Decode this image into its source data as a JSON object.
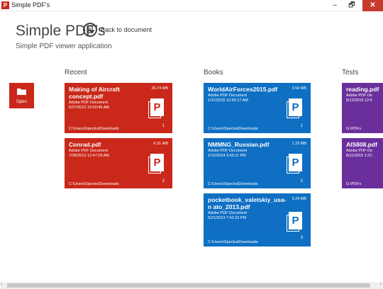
{
  "window": {
    "title": "Simple PDF's",
    "minimize": "–",
    "maximize": "🗗",
    "close": "✕"
  },
  "header": {
    "title": "Simple PDF's",
    "back_label": "Back to document",
    "subtitle": "Simple PDF viewer application"
  },
  "sections": {
    "recent": "Recent",
    "books": "Books",
    "tests": "Tests"
  },
  "open_tile": {
    "label": "Open"
  },
  "recent": [
    {
      "name": "Making of Aircraft concept.pdf",
      "size": "26.74 MB",
      "type": "Adobe PDF Document",
      "date": "5/27/2012 10:50:46 AM",
      "path": "C:\\Users\\Spectra\\Downloads",
      "count": "1"
    },
    {
      "name": "Conrad.pdf",
      "size": "6.31 MB",
      "type": "Adobe PDF Document",
      "date": "7/28/2013 12:47:29 AM",
      "path": "C:\\Users\\Spectra\\Downloads",
      "count": "2"
    }
  ],
  "books": [
    {
      "name": "WorldAirForces2015.pdf",
      "size": "3.58 MB",
      "type": "Adobe PDF Document",
      "date": "1/31/2015 12:56:17 AM",
      "path": "C:\\Users\\Spectra\\Downloads",
      "count": "1"
    },
    {
      "name": "NMMNG_Russian.pdf",
      "size": "1.23 MB",
      "type": "Adobe PDF Document",
      "date": "1/12/2014 3:43:11 PM",
      "path": "C:\\Users\\Spectra\\Downloads",
      "count": "2"
    },
    {
      "name": "pocketbook_valetskiy_usa-n ato_2013.pdf",
      "size": "3.24 MB",
      "type": "Adobe PDF Document",
      "date": "5/21/2013 7:42:22 PM",
      "path": "C:\\Users\\Spectra\\Downloads",
      "count": "3"
    }
  ],
  "tests": [
    {
      "name": "reading.pdf",
      "type": "Adobe PDF Do",
      "date": "8/12/2015 12:4",
      "path": "G:\\PDFs"
    },
    {
      "name": "AIS808.pdf",
      "type": "Adobe PDF Do",
      "date": "8/11/2015 1:21:",
      "path": "G:\\PDFs"
    }
  ],
  "pdf_icon_letter": "P",
  "scroll": {
    "left": "‹",
    "right": "›"
  },
  "colors": {
    "red": "#c9281a",
    "blue": "#0e6fc3",
    "purple": "#6b2f9c"
  }
}
